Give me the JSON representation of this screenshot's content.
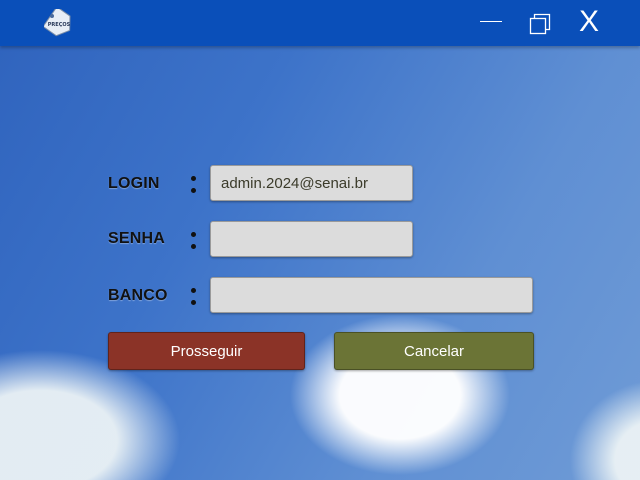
{
  "window": {
    "logo_icon": "price-tag-logo-icon",
    "minimize_icon": "minimize-icon",
    "maximize_icon": "maximize-icon",
    "close_label": "X"
  },
  "form": {
    "login_label": "LOGIN",
    "senha_label": "SENHA",
    "banco_label": "BANCO",
    "login_value": "admin.2024@senai.br",
    "senha_value": "",
    "banco_value": ""
  },
  "buttons": {
    "proceed_label": "Prosseguir",
    "cancel_label": "Cancelar"
  },
  "colors": {
    "titlebar": "#0a4fb9",
    "proceed": "#8b3327",
    "cancel": "#6b7436",
    "field": "#dcdcdc"
  }
}
